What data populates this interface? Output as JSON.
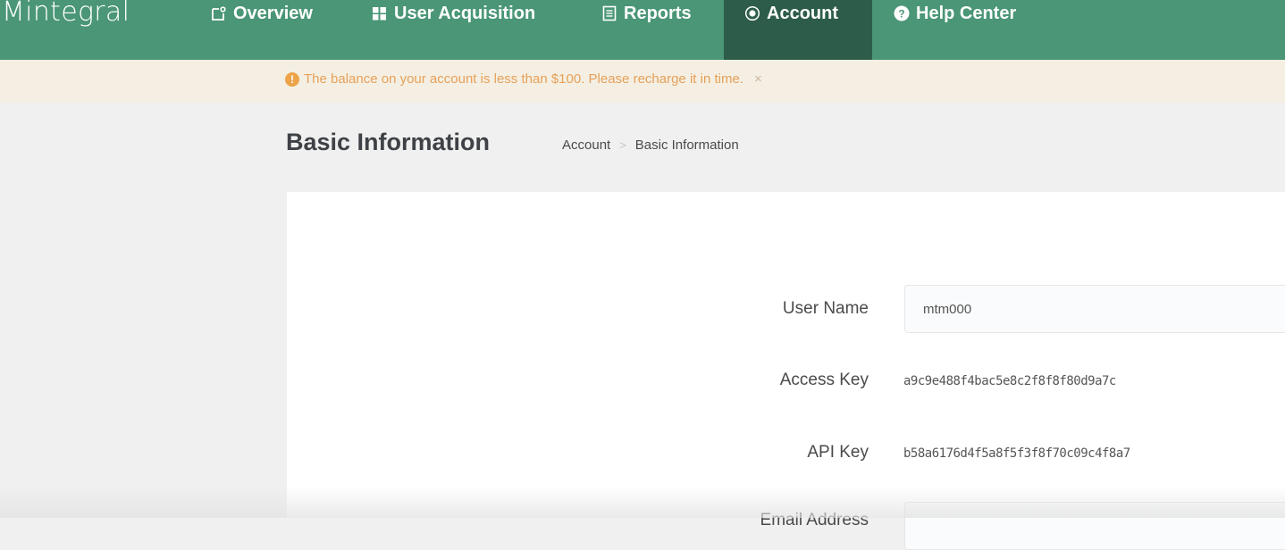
{
  "app": {
    "logo_text": "Mintegral"
  },
  "nav": {
    "items": [
      {
        "label": "Overview",
        "icon": "overview-icon"
      },
      {
        "label": "User Acquisition",
        "icon": "grid-icon"
      },
      {
        "label": "Reports",
        "icon": "document-icon"
      },
      {
        "label": "Account",
        "icon": "account-icon",
        "active": true
      },
      {
        "label": "Help Center",
        "icon": "question-icon"
      }
    ]
  },
  "banner": {
    "icon": "!",
    "message": "The balance on your account is less than $100. Please recharge it in time.",
    "close": "×"
  },
  "header": {
    "title": "Basic Information",
    "breadcrumb": [
      "Account",
      "Basic Information"
    ],
    "breadcrumb_separator": ">"
  },
  "form": {
    "username": {
      "label": "User Name",
      "value": "mtm000"
    },
    "access_key": {
      "label": "Access Key",
      "value": "a9c9e488f4bac5e8c2f8f8f80d9a7c"
    },
    "api_key": {
      "label": "API Key",
      "value": "b58a6176d4f5a8f5f3f8f70c09c4f8a7"
    },
    "email": {
      "label": "Email Address",
      "value": ""
    }
  },
  "colors": {
    "nav_bg": "#4a9676",
    "nav_active_bg": "#2d5d4a",
    "banner_bg": "#f4efe2",
    "banner_text": "#e7a05a"
  }
}
